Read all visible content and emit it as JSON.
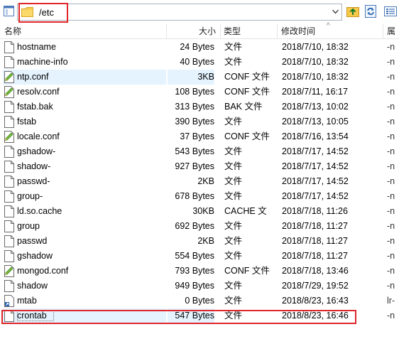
{
  "path_bar": {
    "path": "/etc"
  },
  "columns": {
    "name": "名称",
    "size": "大小",
    "type": "类型",
    "modified": "修改时间",
    "attributes": "属"
  },
  "files": [
    {
      "name": "hostname",
      "size": "24 Bytes",
      "type": "文件",
      "modified": "2018/7/10, 18:32",
      "attr": "-n",
      "icon": "file"
    },
    {
      "name": "machine-info",
      "size": "40 Bytes",
      "type": "文件",
      "modified": "2018/7/10, 18:32",
      "attr": "-n",
      "icon": "file"
    },
    {
      "name": "ntp.conf",
      "size": "3KB",
      "type": "CONF 文件",
      "modified": "2018/7/10, 18:32",
      "attr": "-n",
      "icon": "conf"
    },
    {
      "name": "resolv.conf",
      "size": "108 Bytes",
      "type": "CONF 文件",
      "modified": "2018/7/11, 16:17",
      "attr": "-n",
      "icon": "conf"
    },
    {
      "name": "fstab.bak",
      "size": "313 Bytes",
      "type": "BAK 文件",
      "modified": "2018/7/13, 10:02",
      "attr": "-n",
      "icon": "file"
    },
    {
      "name": "fstab",
      "size": "390 Bytes",
      "type": "文件",
      "modified": "2018/7/13, 10:05",
      "attr": "-n",
      "icon": "file"
    },
    {
      "name": "locale.conf",
      "size": "37 Bytes",
      "type": "CONF 文件",
      "modified": "2018/7/16, 13:54",
      "attr": "-n",
      "icon": "conf"
    },
    {
      "name": "gshadow-",
      "size": "543 Bytes",
      "type": "文件",
      "modified": "2018/7/17, 14:52",
      "attr": "-n",
      "icon": "file"
    },
    {
      "name": "shadow-",
      "size": "927 Bytes",
      "type": "文件",
      "modified": "2018/7/17, 14:52",
      "attr": "-n",
      "icon": "file"
    },
    {
      "name": "passwd-",
      "size": "2KB",
      "type": "文件",
      "modified": "2018/7/17, 14:52",
      "attr": "-n",
      "icon": "file"
    },
    {
      "name": "group-",
      "size": "678 Bytes",
      "type": "文件",
      "modified": "2018/7/17, 14:52",
      "attr": "-n",
      "icon": "file"
    },
    {
      "name": "ld.so.cache",
      "size": "30KB",
      "type": "CACHE 文",
      "modified": "2018/7/18, 11:26",
      "attr": "-n",
      "icon": "file"
    },
    {
      "name": "group",
      "size": "692 Bytes",
      "type": "文件",
      "modified": "2018/7/18, 11:27",
      "attr": "-n",
      "icon": "file"
    },
    {
      "name": "passwd",
      "size": "2KB",
      "type": "文件",
      "modified": "2018/7/18, 11:27",
      "attr": "-n",
      "icon": "file"
    },
    {
      "name": "gshadow",
      "size": "554 Bytes",
      "type": "文件",
      "modified": "2018/7/18, 11:27",
      "attr": "-n",
      "icon": "file"
    },
    {
      "name": "mongod.conf",
      "size": "793 Bytes",
      "type": "CONF 文件",
      "modified": "2018/7/18, 13:46",
      "attr": "-n",
      "icon": "conf"
    },
    {
      "name": "shadow",
      "size": "949 Bytes",
      "type": "文件",
      "modified": "2018/7/29, 19:52",
      "attr": "-n",
      "icon": "file"
    },
    {
      "name": "mtab",
      "size": "0 Bytes",
      "type": "文件",
      "modified": "2018/8/23, 16:43",
      "attr": "lr-",
      "icon": "link"
    },
    {
      "name": "crontab",
      "size": "547 Bytes",
      "type": "文件",
      "modified": "2018/8/23, 16:46",
      "attr": "-n",
      "icon": "file"
    }
  ],
  "selected_files": [
    "ntp.conf",
    "crontab"
  ],
  "colors": {
    "highlight_red": "#e0262b",
    "selection": "#e5f3ff",
    "folder": "#f6c94a"
  }
}
